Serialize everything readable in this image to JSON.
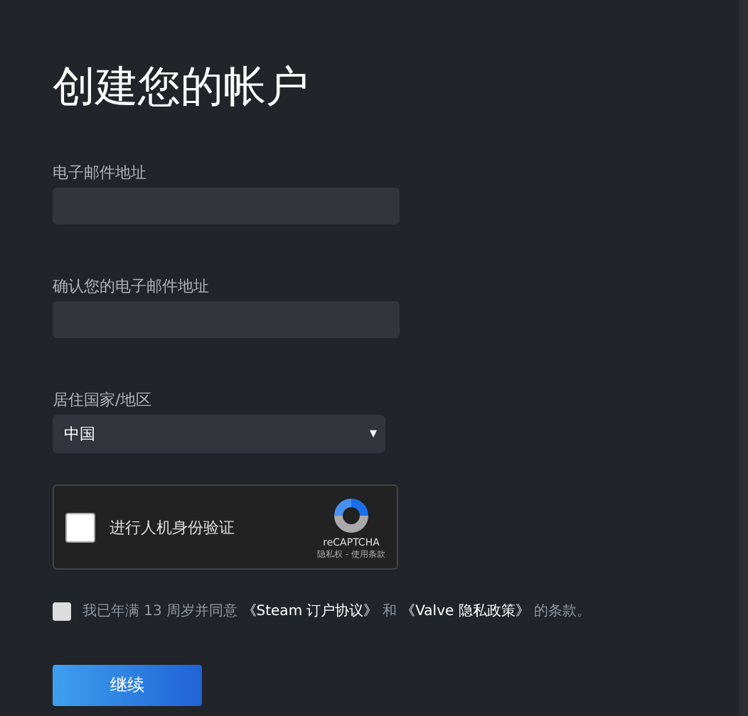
{
  "title": "创建您的帐户",
  "fields": [
    {
      "label": "电子邮件地址"
    },
    {
      "label": "确认您的电子邮件地址"
    }
  ],
  "country": {
    "label": "居住国家/地区",
    "value": "中国",
    "caret": "▾"
  },
  "captcha": {
    "checked": false,
    "label": "进行人机身份验证",
    "brand": "reCAPTCHA",
    "links": "隐私权 - 使用条款"
  },
  "agreement": {
    "checked": false,
    "before": "我已年满 13 周岁并同意",
    "link_1": "《Steam 订户协议》",
    "middle": "和",
    "link_2": "《Valve 隐私政策》",
    "after": "的条款。"
  },
  "button": "继续"
}
